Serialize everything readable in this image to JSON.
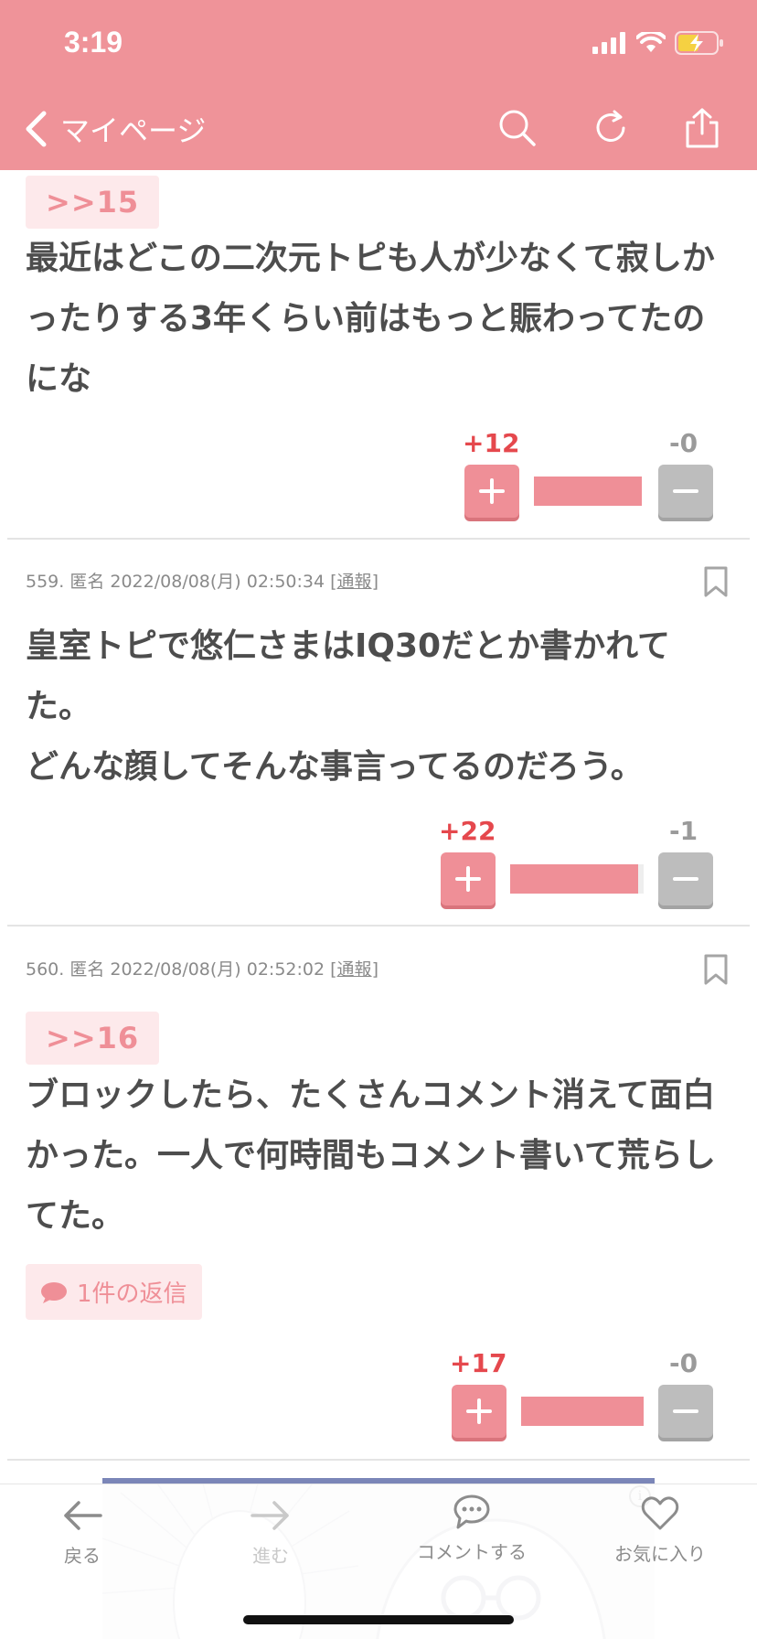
{
  "status_bar": {
    "time": "3:19"
  },
  "nav": {
    "back_label": "マイページ"
  },
  "comments": [
    {
      "quote": ">>15",
      "text": "最近はどこの二次元トピも人が少なくて寂しかったりする3年くらい前はもっと賑わってたのにな",
      "plus": "+12",
      "minus": "-0",
      "plus_ratio": 1.0
    },
    {
      "meta": "559. 匿名 2022/08/08(月) 02:50:34",
      "report": "通報",
      "text": "皇室トピで悠仁さまはIQ30だとか書かれてた。\nどんな顔してそんな事言ってるのだろう。",
      "plus": "+22",
      "minus": "-1",
      "plus_ratio": 0.96
    },
    {
      "meta": "560. 匿名 2022/08/08(月) 02:52:02",
      "report": "通報",
      "quote": ">>16",
      "text": "ブロックしたら、たくさんコメント消えて面白かった。一人で何時間もコメント書いて荒らしてた。",
      "reply": "1件の返信",
      "plus": "+17",
      "minus": "-0",
      "plus_ratio": 1.0
    }
  ],
  "toolbar": {
    "back": "戻る",
    "forward": "進む",
    "comment": "コメントする",
    "favorite": "お気に入り"
  },
  "colors": {
    "accent": "#ef9399",
    "plus": "#e5484d"
  }
}
